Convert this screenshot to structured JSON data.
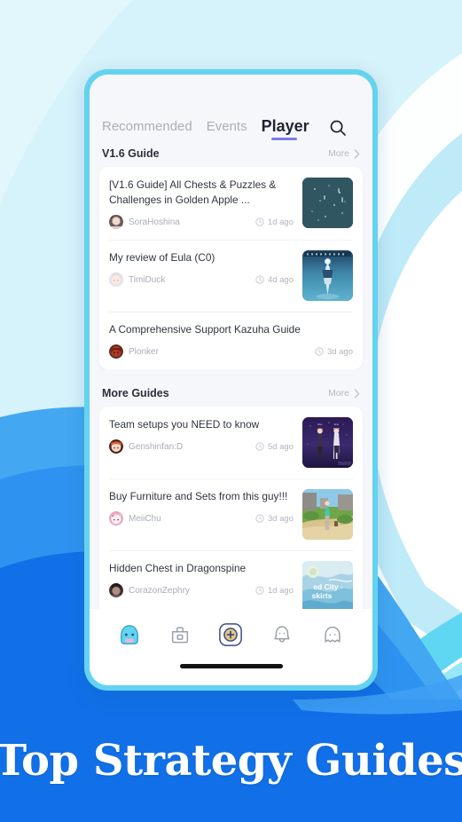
{
  "hero": {
    "headline": "Top Strategy Guides"
  },
  "colors": {
    "background_light": "#D6F2FA",
    "background_blue": "#1170E8",
    "phone_frame": "#63D3F0",
    "screen_bg": "#F6F7FA",
    "tab_active_underline": "#7B7CE8",
    "text_primary": "#30353F",
    "text_muted": "#A8ADB7"
  },
  "tabs": [
    {
      "label": "Recommended",
      "active": false
    },
    {
      "label": "Events",
      "active": false
    },
    {
      "label": "Player",
      "active": true
    }
  ],
  "search": {
    "icon": "search-icon",
    "label": "Search"
  },
  "sections": [
    {
      "title": "V1.6 Guide",
      "more_label": "More",
      "items": [
        {
          "title": "[V1.6 Guide] All Chests & Puzzles & Challenges in Golden Apple ...",
          "author": "SoraHoshina",
          "time": "1d ago",
          "thumb": "dark-teal-night-map",
          "has_thumb": true
        },
        {
          "title": "My review of Eula (C0)",
          "author": "TimiDuck",
          "time": "4d ago",
          "thumb": "blue-character-portrait",
          "has_thumb": true
        },
        {
          "title": "A Comprehensive Support Kazuha Guide",
          "author": "Plonker",
          "time": "3d ago",
          "thumb": "",
          "has_thumb": false
        }
      ]
    },
    {
      "title": "More Guides",
      "more_label": "More",
      "items": [
        {
          "title": "Team setups you NEED to know",
          "author": "Genshinfan:D",
          "time": "5d ago",
          "thumb": "purple-two-characters",
          "has_thumb": true
        },
        {
          "title": "Buy Furniture and Sets from this guy!!!",
          "author": "MeiiChu",
          "time": "3d ago",
          "thumb": "green-village-scene",
          "has_thumb": true
        },
        {
          "title": "Hidden Chest in Dragonspine",
          "author": "CorazonZephry",
          "time": "1d ago",
          "thumb": "blue-map-ruined-city",
          "thumb_overlay": "ed City - skirts",
          "has_thumb": true
        }
      ]
    }
  ],
  "bottom_nav": [
    {
      "icon": "slime-home-icon",
      "active": true
    },
    {
      "icon": "toolbox-icon",
      "active": false
    },
    {
      "icon": "plus-badge-icon",
      "active": false
    },
    {
      "icon": "bell-notification-icon",
      "active": false
    },
    {
      "icon": "ghost-profile-icon",
      "active": false
    }
  ]
}
